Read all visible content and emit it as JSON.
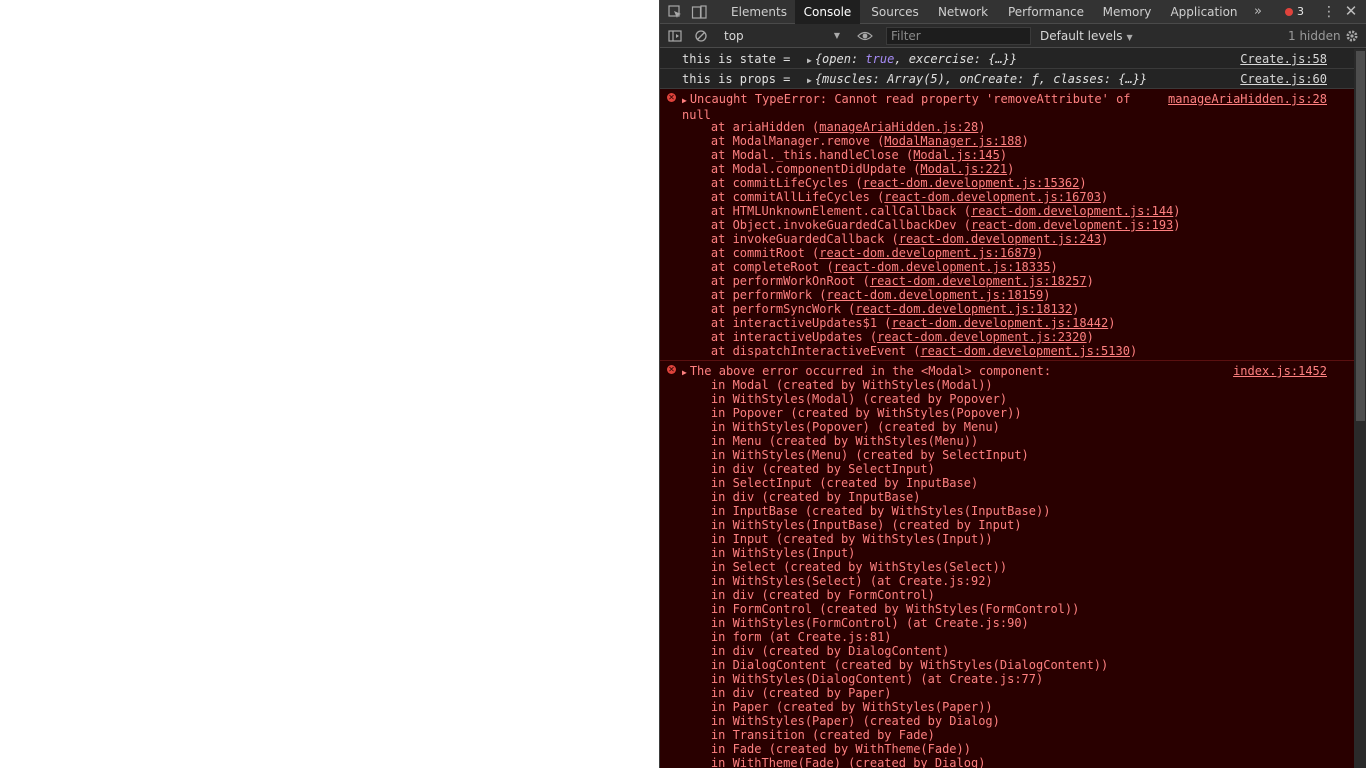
{
  "tabs": [
    "Elements",
    "Console",
    "Sources",
    "Network",
    "Performance",
    "Memory",
    "Application"
  ],
  "active_tab": "Console",
  "error_count": "3",
  "toolbar": {
    "context": "top",
    "filter_placeholder": "Filter",
    "levels": "Default levels",
    "hidden": "1 hidden"
  },
  "icons": {
    "inspect": "inspect-element-icon",
    "device": "device-toolbar-icon",
    "sidebar": "console-sidebar-icon",
    "clear": "clear-console-icon",
    "eye": "live-expression-eye-icon",
    "settings": "settings-gear-icon",
    "more": "chevron-double-right-icon",
    "kebab": "vertical-dots-icon",
    "close": "close-icon"
  },
  "colors": {
    "error_bg": "#290000",
    "error_text": "#ff8080",
    "error_icon": "#e0433c",
    "keyword": "#a78cf6"
  },
  "messages": {
    "log1": {
      "text": "this is state =",
      "obj_a": "{open: ",
      "obj_kw": "true",
      "obj_b": ", excercise: {…}}",
      "source": "Create.js:58"
    },
    "log2": {
      "text": "this is props =",
      "obj": "{muscles: Array(5), onCreate: ƒ, classes: {…}}",
      "source": "Create.js:60"
    },
    "error1": {
      "head_line1": "Uncaught TypeError: Cannot read property 'removeAttribute' of",
      "head_line2": "null",
      "source": "manageAriaHidden.js:28",
      "stack": [
        {
          "fn": "    at ariaHidden (",
          "file": "manageAriaHidden.js:28"
        },
        {
          "fn": "    at ModalManager.remove (",
          "file": "ModalManager.js:188"
        },
        {
          "fn": "    at Modal._this.handleClose (",
          "file": "Modal.js:145"
        },
        {
          "fn": "    at Modal.componentDidUpdate (",
          "file": "Modal.js:221"
        },
        {
          "fn": "    at commitLifeCycles (",
          "file": "react-dom.development.js:15362"
        },
        {
          "fn": "    at commitAllLifeCycles (",
          "file": "react-dom.development.js:16703"
        },
        {
          "fn": "    at HTMLUnknownElement.callCallback (",
          "file": "react-dom.development.js:144"
        },
        {
          "fn": "    at Object.invokeGuardedCallbackDev (",
          "file": "react-dom.development.js:193"
        },
        {
          "fn": "    at invokeGuardedCallback (",
          "file": "react-dom.development.js:243"
        },
        {
          "fn": "    at commitRoot (",
          "file": "react-dom.development.js:16879"
        },
        {
          "fn": "    at completeRoot (",
          "file": "react-dom.development.js:18335"
        },
        {
          "fn": "    at performWorkOnRoot (",
          "file": "react-dom.development.js:18257"
        },
        {
          "fn": "    at performWork (",
          "file": "react-dom.development.js:18159"
        },
        {
          "fn": "    at performSyncWork (",
          "file": "react-dom.development.js:18132"
        },
        {
          "fn": "    at interactiveUpdates$1 (",
          "file": "react-dom.development.js:18442"
        },
        {
          "fn": "    at interactiveUpdates (",
          "file": "react-dom.development.js:2320"
        },
        {
          "fn": "    at dispatchInteractiveEvent (",
          "file": "react-dom.development.js:5130"
        }
      ]
    },
    "error2": {
      "head": "The above error occurred in the <Modal> component:",
      "source": "index.js:1452",
      "lines": [
        "    in Modal (created by WithStyles(Modal))",
        "    in WithStyles(Modal) (created by Popover)",
        "    in Popover (created by WithStyles(Popover))",
        "    in WithStyles(Popover) (created by Menu)",
        "    in Menu (created by WithStyles(Menu))",
        "    in WithStyles(Menu) (created by SelectInput)",
        "    in div (created by SelectInput)",
        "    in SelectInput (created by InputBase)",
        "    in div (created by InputBase)",
        "    in InputBase (created by WithStyles(InputBase))",
        "    in WithStyles(InputBase) (created by Input)",
        "    in Input (created by WithStyles(Input))",
        "    in WithStyles(Input)",
        "    in Select (created by WithStyles(Select))",
        "    in WithStyles(Select) (at Create.js:92)",
        "    in div (created by FormControl)",
        "    in FormControl (created by WithStyles(FormControl))",
        "    in WithStyles(FormControl) (at Create.js:90)",
        "    in form (at Create.js:81)",
        "    in div (created by DialogContent)",
        "    in DialogContent (created by WithStyles(DialogContent))",
        "    in WithStyles(DialogContent) (at Create.js:77)",
        "    in div (created by Paper)",
        "    in Paper (created by WithStyles(Paper))",
        "    in WithStyles(Paper) (created by Dialog)",
        "    in Transition (created by Fade)",
        "    in Fade (created by WithTheme(Fade))",
        "    in WithTheme(Fade) (created by Dialog)"
      ]
    }
  }
}
